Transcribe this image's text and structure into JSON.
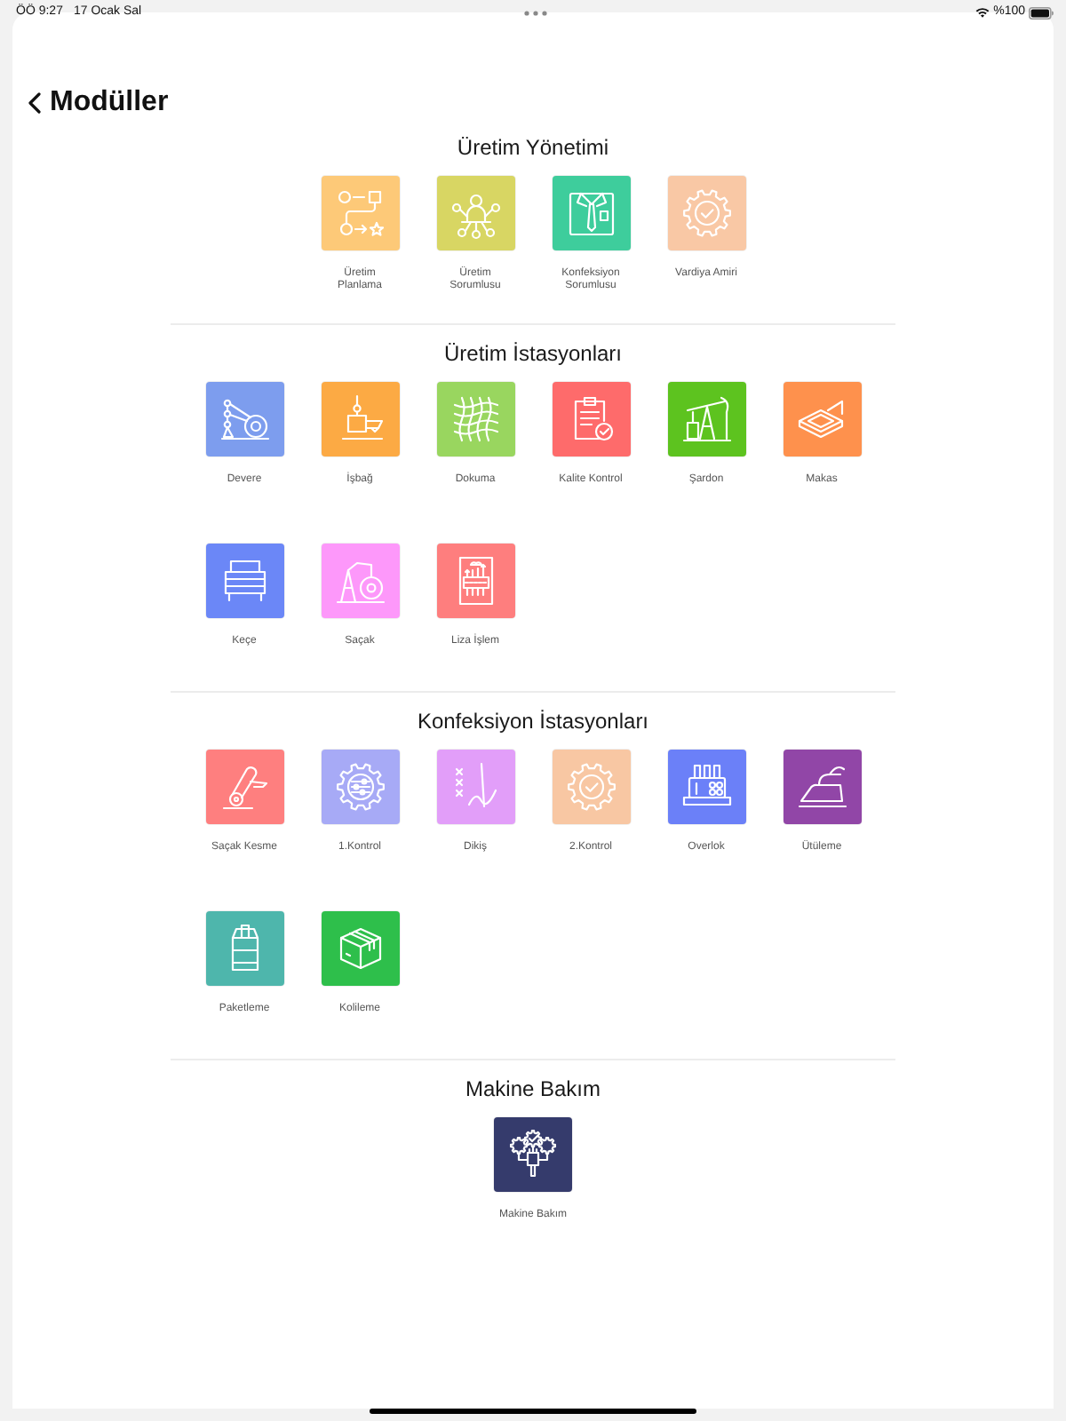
{
  "status_bar": {
    "time": "ÖÖ 9:27",
    "date": "17 Ocak Sal",
    "battery": "%100"
  },
  "header": {
    "title": "Modüller"
  },
  "sections": [
    {
      "title": "Üretim Yönetimi",
      "modules": [
        {
          "label": "Üretim Planlama",
          "color": "#fdc978"
        },
        {
          "label": "Üretim Sorumlusu",
          "color": "#d8d663"
        },
        {
          "label": "Konfeksiyon Sorumlusu",
          "color": "#3ecd9c"
        },
        {
          "label": "Vardiya Amiri",
          "color": "#f9c8a5"
        }
      ]
    },
    {
      "title": "Üretim İstasyonları",
      "modules": [
        {
          "label": "Devere",
          "color": "#7d9dee"
        },
        {
          "label": "İşbağ",
          "color": "#fcaa44"
        },
        {
          "label": "Dokuma",
          "color": "#99d65f"
        },
        {
          "label": "Kalite Kontrol",
          "color": "#fe6b6b"
        },
        {
          "label": "Şardon",
          "color": "#5dc31f"
        },
        {
          "label": "Makas",
          "color": "#fe914d"
        },
        {
          "label": "Keçe",
          "color": "#6b87f7"
        },
        {
          "label": "Saçak",
          "color": "#fd98fa"
        },
        {
          "label": "Liza İşlem",
          "color": "#fe7e7e"
        }
      ]
    },
    {
      "title": "Konfeksiyon İstasyonları",
      "modules": [
        {
          "label": "Saçak Kesme",
          "color": "#fe7f7f"
        },
        {
          "label": "1.Kontrol",
          "color": "#a7aaf6"
        },
        {
          "label": "Dikiş",
          "color": "#e29ef9"
        },
        {
          "label": "2.Kontrol",
          "color": "#f8c7a3"
        },
        {
          "label": "Overlok",
          "color": "#6b80f8"
        },
        {
          "label": "Ütüleme",
          "color": "#9146a7"
        },
        {
          "label": "Paketleme",
          "color": "#4eb6ac"
        },
        {
          "label": "Kolileme",
          "color": "#2ebf4b"
        }
      ]
    },
    {
      "title": "Makine Bakım",
      "modules": [
        {
          "label": "Makine Bakım",
          "color": "#353b6c"
        }
      ]
    }
  ]
}
